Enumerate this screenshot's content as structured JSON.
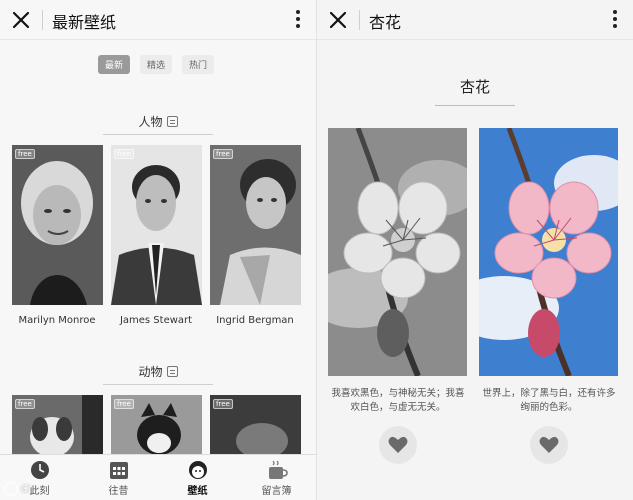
{
  "left": {
    "title": "最新壁纸",
    "tabs": [
      {
        "label": "最新"
      },
      {
        "label": "精选"
      },
      {
        "label": "热门"
      }
    ],
    "sections": [
      {
        "title": "人物",
        "items": [
          {
            "name": "Marilyn Monroe",
            "badge": "free"
          },
          {
            "name": "James Stewart",
            "badge": "free"
          },
          {
            "name": "Ingrid Bergman",
            "badge": "free"
          }
        ]
      },
      {
        "title": "动物",
        "items": [
          {
            "badge": "free"
          },
          {
            "badge": "free"
          },
          {
            "badge": "free"
          }
        ]
      }
    ],
    "nav": [
      {
        "label": "此刻",
        "icon": "clock-icon"
      },
      {
        "label": "往昔",
        "icon": "calendar-icon"
      },
      {
        "label": "壁纸",
        "icon": "wallpaper-icon",
        "active": true
      },
      {
        "label": "留言簿",
        "icon": "cup-icon"
      }
    ],
    "watermark": "Ci"
  },
  "right": {
    "title": "杏花",
    "heading": "杏花",
    "cards": [
      {
        "style": "grayscale",
        "text": "我喜欢黑色，与神秘无关；我喜欢白色，与虚无无关。"
      },
      {
        "style": "color",
        "text": "世界上，除了黑与白，还有许多绚丽的色彩。"
      }
    ]
  },
  "colors": {
    "active_tab": "#9a9a9a",
    "sky": "#3f7fcf",
    "petal": "#f2b8c8"
  }
}
